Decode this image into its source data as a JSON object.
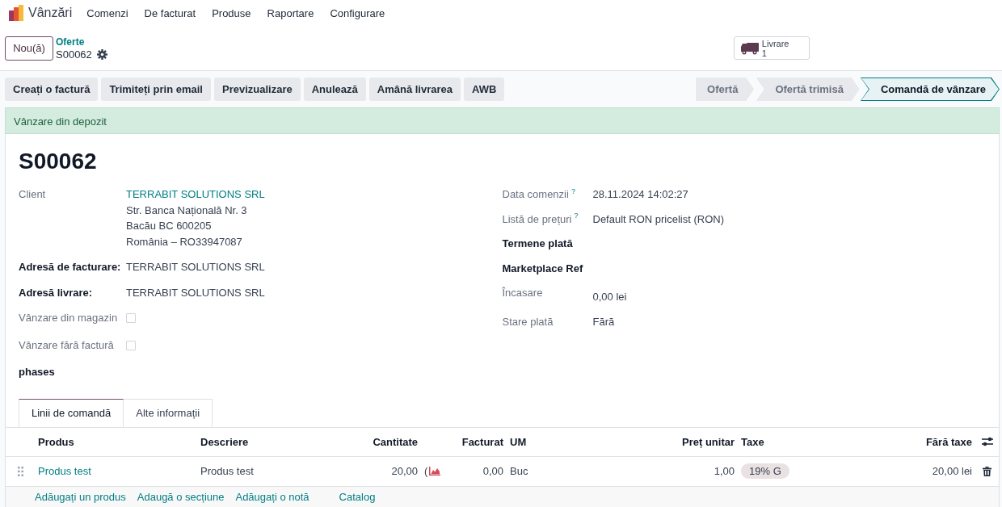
{
  "app": {
    "name": "Vânzări",
    "menu": [
      "Comenzi",
      "De facturat",
      "Produse",
      "Raportare",
      "Configurare"
    ]
  },
  "control_panel": {
    "new_button": "Nou(ă)",
    "breadcrumb": {
      "parent": "Oferte",
      "current": "S00062"
    },
    "smart_button": {
      "label": "Livrare",
      "count": "1"
    }
  },
  "actions": [
    "Creați o factură",
    "Trimiteți prin email",
    "Previzualizare",
    "Anulează",
    "Amână livrarea",
    "AWB"
  ],
  "stages": [
    {
      "label": "Ofertă",
      "selected": false
    },
    {
      "label": "Ofertă trimisă",
      "selected": false
    },
    {
      "label": "Comandă de vânzare",
      "selected": true
    }
  ],
  "ribbon": "Vânzare din depozit",
  "title": "S00062",
  "left_fields": [
    {
      "kind": "text",
      "label": "Client",
      "strong": false,
      "link_first": true,
      "lines": [
        "TERRABIT SOLUTIONS SRL",
        "Str. Banca Națională Nr. 3",
        "Bacău BC 600205",
        "România – RO33947087"
      ]
    },
    {
      "kind": "text",
      "label": "Adresă de facturare:",
      "strong": true,
      "lines": [
        "TERRABIT SOLUTIONS SRL"
      ]
    },
    {
      "kind": "text",
      "label": "Adresă livrare:",
      "strong": true,
      "lines": [
        "TERRABIT SOLUTIONS SRL"
      ]
    },
    {
      "kind": "checkbox",
      "label": "Vânzare din magazin",
      "strong": false,
      "checked": false
    },
    {
      "kind": "checkbox",
      "label": "Vânzare fără factură",
      "strong": false,
      "checked": false
    },
    {
      "kind": "text",
      "label": "phases",
      "strong": true
    }
  ],
  "right_fields": [
    {
      "kind": "text",
      "label": "Data comenzii",
      "help": "?",
      "strong": false,
      "lines": [
        "28.11.2024 14:02:27"
      ]
    },
    {
      "kind": "text",
      "label": "Listă de prețuri",
      "help": "?",
      "strong": false,
      "lines": [
        "Default RON pricelist (RON)"
      ]
    },
    {
      "kind": "text",
      "label": "Termene plată",
      "strong": true
    },
    {
      "kind": "text",
      "label": "Marketplace Ref",
      "strong": true
    },
    {
      "kind": "text",
      "label": "Încasare",
      "strong": false,
      "offset": true,
      "lines": [
        "0,00 lei"
      ]
    },
    {
      "kind": "text",
      "label": "Stare plată",
      "strong": false,
      "lines": [
        "Fără"
      ]
    }
  ],
  "tabs": [
    {
      "label": "Linii de comandă",
      "selected": true
    },
    {
      "label": "Alte informații",
      "selected": false
    }
  ],
  "table": {
    "columns": [
      {
        "label": "Produs",
        "numeric": false
      },
      {
        "label": "Descriere",
        "numeric": false
      },
      {
        "label": "Cantitate",
        "numeric": true
      },
      {
        "label": "Facturat",
        "numeric": true
      },
      {
        "label": "UM",
        "numeric": false
      },
      {
        "label": "Preț unitar",
        "numeric": true
      },
      {
        "label": "Taxe",
        "numeric": false
      },
      {
        "label": "Fără taxe",
        "numeric": true
      }
    ],
    "rows": [
      {
        "product": "Produs test",
        "description": "Produs test",
        "quantity": "20,00",
        "quantity_extra": "(",
        "invoiced": "0,00",
        "uom": "Buc",
        "unit_price": "1,00",
        "taxes": [
          "19% G"
        ],
        "subtotal": "20,00 lei"
      }
    ],
    "footer_links": [
      "Adăugați un produs",
      "Adaugă o secțiune",
      "Adăugați o notă",
      "Catalog"
    ]
  }
}
